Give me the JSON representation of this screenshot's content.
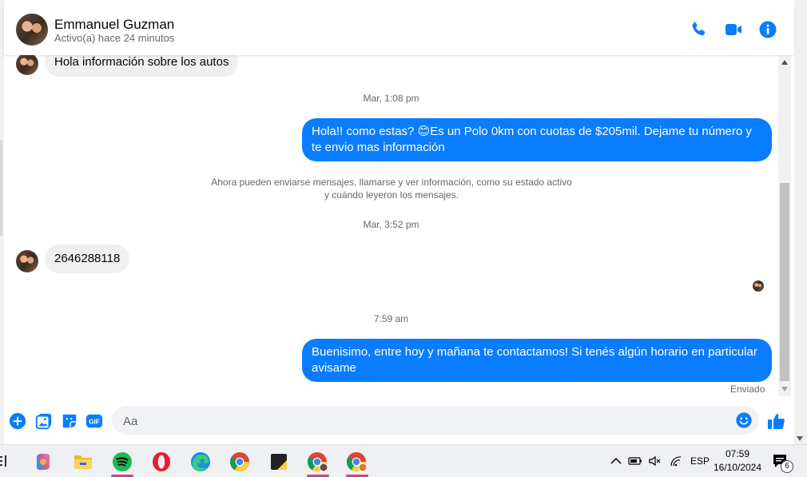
{
  "header": {
    "name": "Emmanuel Guzman",
    "status": "Activo(a) hace 24 minutos",
    "icons": [
      "phone-icon",
      "video-camera-icon",
      "info-icon"
    ]
  },
  "messages": {
    "first_incoming": "Hola información sobre los autos",
    "time_1": "Mar, 1:08 pm",
    "outgoing_1": "Hola!! como estas? 😊Es un Polo 0km con cuotas de $205mil. Dejame tu número y te envio mas información",
    "system_note": "Ahora pueden enviarse mensajes, llamarse y ver información, como su estado activo y cuándo leyeron los mensajes.",
    "time_2": "Mar, 3:52 pm",
    "incoming_2": "2646288118",
    "time_3": "7:59 am",
    "outgoing_2": "Buenisimo, entre hoy y mañana te contactamos! Si tenés algún horario en particular avisame",
    "sent_status": "Enviado"
  },
  "composer": {
    "placeholder": "Aa",
    "gif_label": "GIF",
    "icons": [
      "plus-icon",
      "image-icon",
      "sticker-icon",
      "gif-icon",
      "emoji-icon",
      "thumbs-up-icon"
    ]
  },
  "taskbar": {
    "apps": [
      "copilot-icon",
      "file-explorer-icon",
      "spotify-icon",
      "opera-icon",
      "edge-icon",
      "chrome-icon",
      "sticky-notes-icon",
      "chrome-profile-icon",
      "chrome-profile-icon-2"
    ],
    "language": "ESP",
    "time": "07:59",
    "date": "16/10/2024",
    "notification_count": "6"
  },
  "colors": {
    "accent": "#0a7cff",
    "incoming_bubble": "#f0f0f0",
    "taskbar": "#eef0f4"
  }
}
